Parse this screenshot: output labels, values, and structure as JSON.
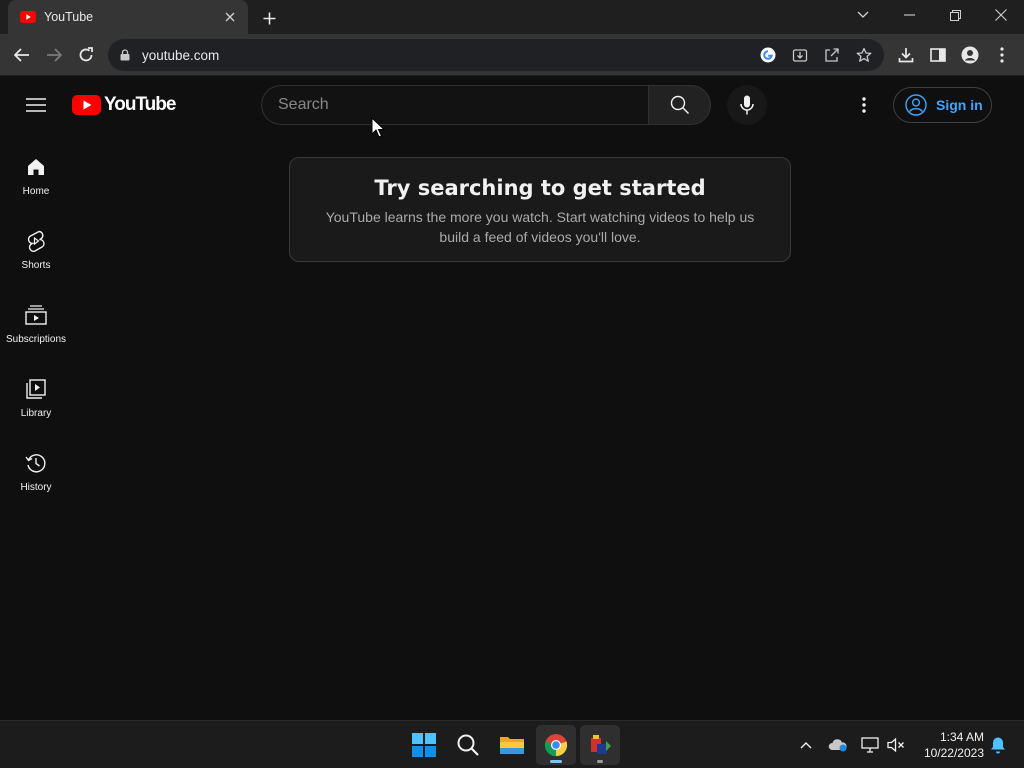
{
  "browser": {
    "tab_title": "YouTube",
    "url": "youtube.com"
  },
  "youtube": {
    "logo_text": "YouTube",
    "search_placeholder": "Search",
    "signin_label": "Sign in",
    "guide": [
      {
        "label": "Home",
        "icon": "home-icon"
      },
      {
        "label": "Shorts",
        "icon": "shorts-icon"
      },
      {
        "label": "Subscriptions",
        "icon": "subscriptions-icon"
      },
      {
        "label": "Library",
        "icon": "library-icon"
      },
      {
        "label": "History",
        "icon": "history-icon"
      }
    ],
    "prompt": {
      "title": "Try searching to get started",
      "subtitle": "YouTube learns the more you watch. Start watching videos to help us build a feed of videos you'll love."
    }
  },
  "taskbar": {
    "time": "1:34 AM",
    "date": "10/22/2023"
  },
  "colors": {
    "background": "#0f0f0f",
    "youtube_red": "#ff0000",
    "link_blue": "#3ea6ff"
  }
}
